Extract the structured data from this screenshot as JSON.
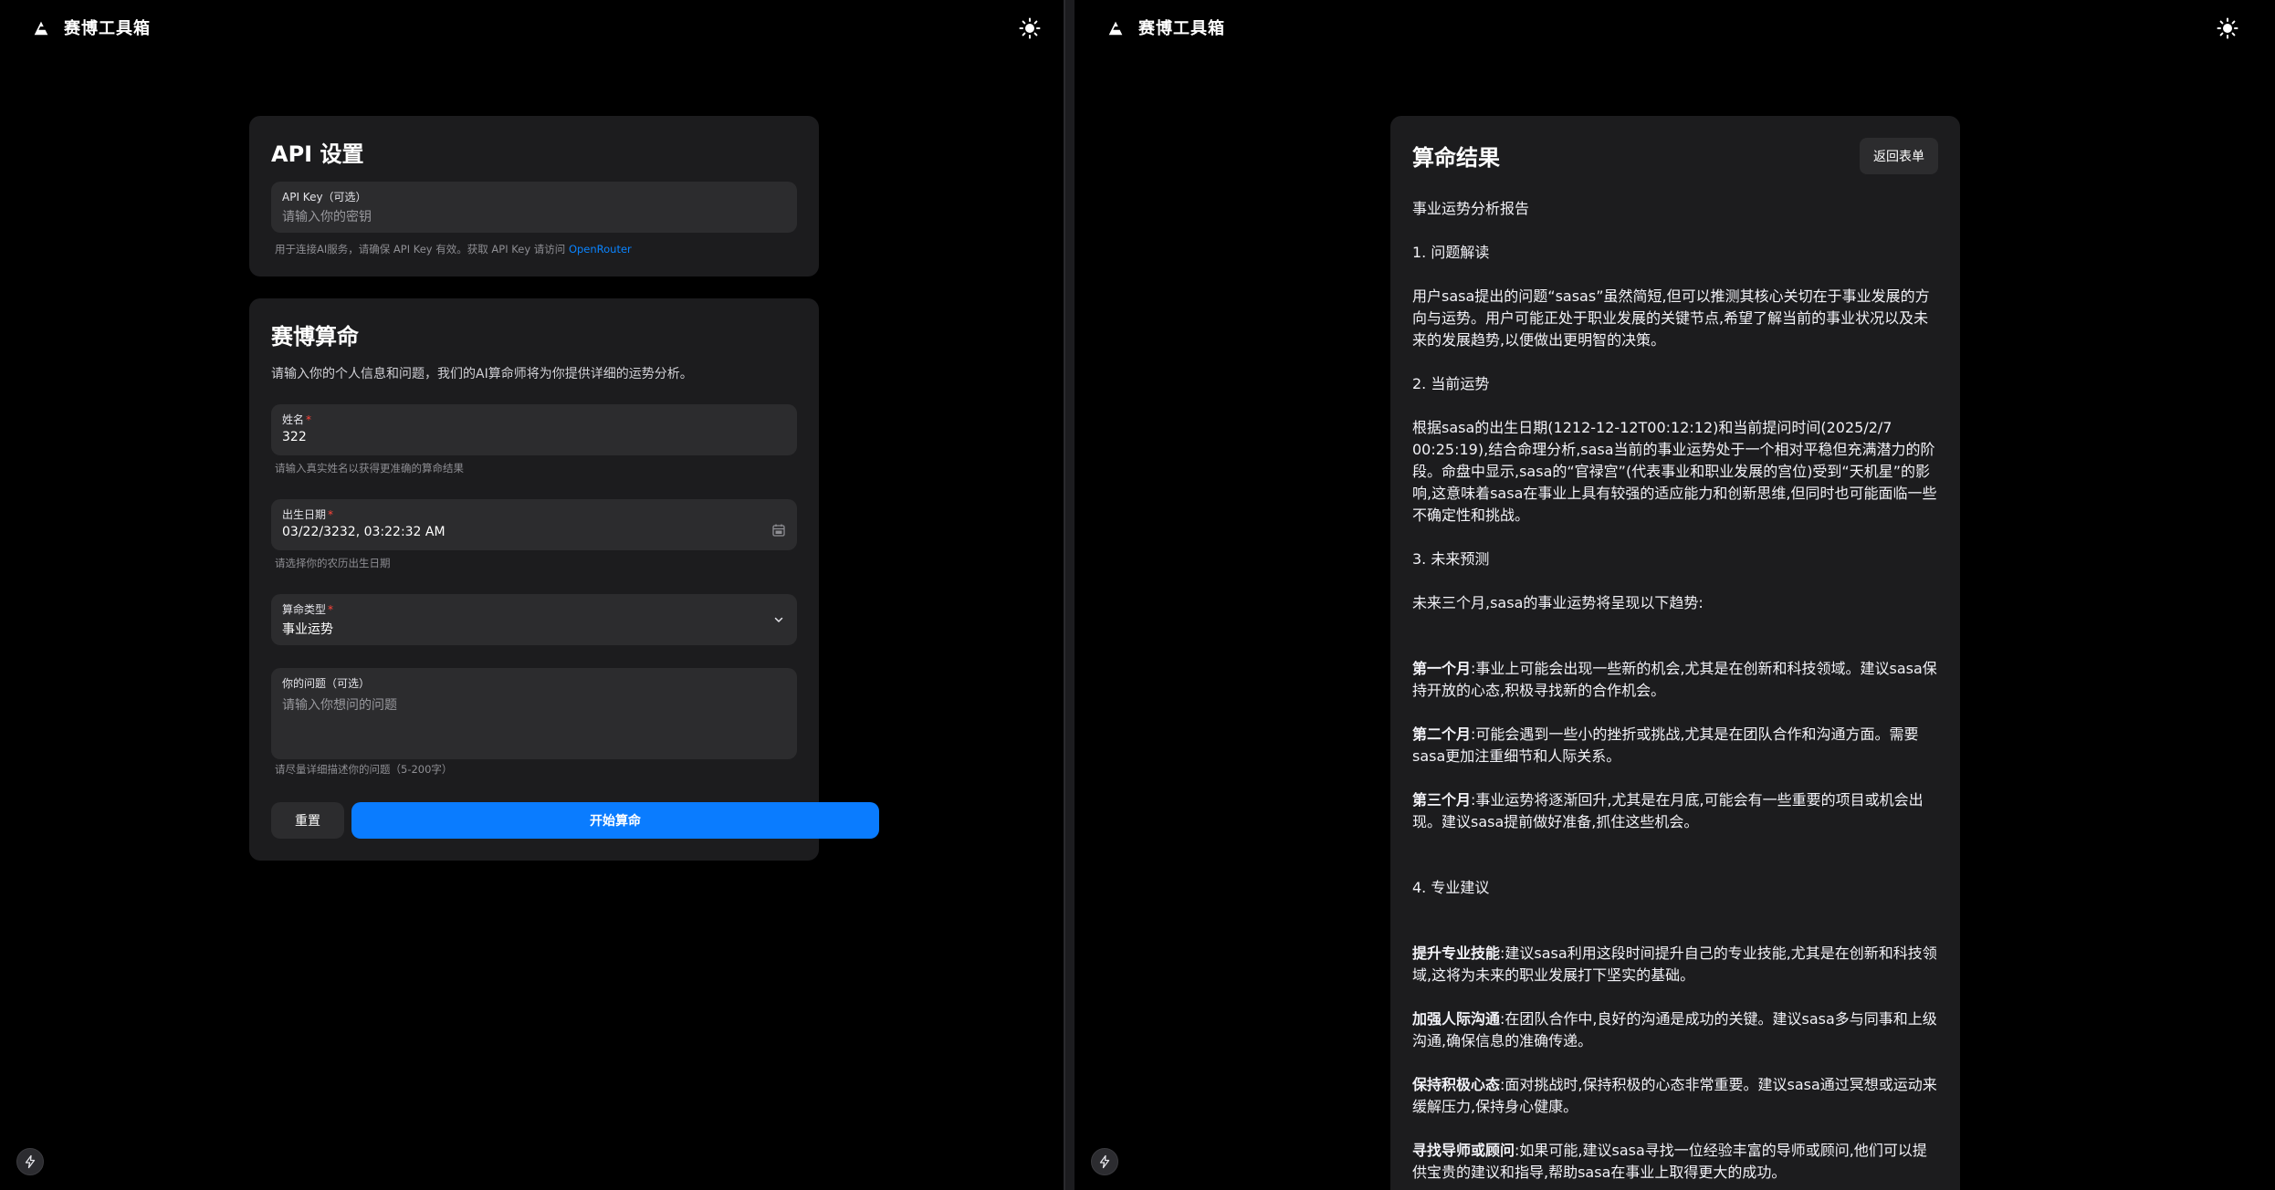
{
  "app": {
    "brand_name": "赛博工具箱"
  },
  "api_card": {
    "title": "API 设置",
    "key_label": "API Key（可选）",
    "key_placeholder": "请输入你的密钥",
    "hint_prefix": "用于连接AI服务，请确保 API Key 有效。获取 API Key 请访问",
    "hint_link": "OpenRouter"
  },
  "form_card": {
    "title": "赛博算命",
    "description": "请输入你的个人信息和问题，我们的AI算命师将为你提供详细的运势分析。",
    "name_label": "姓名",
    "name_value": "322",
    "name_hint": "请输入真实姓名以获得更准确的算命结果",
    "birth_label": "出生日期",
    "birth_value": "03/22/3232, 03:22:32 AM",
    "birth_hint": "请选择你的农历出生日期",
    "type_label": "算命类型",
    "type_value": "事业运势",
    "question_label": "你的问题（可选）",
    "question_placeholder": "请输入你想问的问题",
    "question_hint": "请尽量详细描述你的问题（5-200字）",
    "reset_label": "重置",
    "submit_label": "开始算命"
  },
  "result": {
    "title": "算命结果",
    "back_label": "返回表单",
    "report_title": "事业运势分析报告",
    "s1_heading": "1. 问题解读",
    "s1_text": "用户sasa提出的问题“sasas”虽然简短,但可以推测其核心关切在于事业发展的方向与运势。用户可能正处于职业发展的关键节点,希望了解当前的事业状况以及未来的发展趋势,以便做出更明智的决策。",
    "s2_heading": "2. 当前运势",
    "s2_text": "根据sasa的出生日期(1212-12-12T00:12:12)和当前提问时间(2025/2/7 00:25:19),结合命理分析,sasa当前的事业运势处于一个相对平稳但充满潜力的阶段。命盘中显示,sasa的“官禄宫”(代表事业和职业发展的宫位)受到“天机星”的影响,这意味着sasa在事业上具有较强的适应能力和创新思维,但同时也可能面临一些不确定性和挑战。",
    "s3_heading": "3. 未来预测",
    "s3_intro": "未来三个月,sasa的事业运势将呈现以下趋势:",
    "m1_label": "第一个月",
    "m1_text": ":事业上可能会出现一些新的机会,尤其是在创新和科技领域。建议sasa保持开放的心态,积极寻找新的合作机会。",
    "m2_label": "第二个月",
    "m2_text": ":可能会遇到一些小的挫折或挑战,尤其是在团队合作和沟通方面。需要sasa更加注重细节和人际关系。",
    "m3_label": "第三个月",
    "m3_text": ":事业运势将逐渐回升,尤其是在月底,可能会有一些重要的项目或机会出现。建议sasa提前做好准备,抓住这些机会。",
    "s4_heading": "4. 专业建议",
    "a1_label": "提升专业技能",
    "a1_text": ":建议sasa利用这段时间提升自己的专业技能,尤其是在创新和科技领域,这将为未来的职业发展打下坚实的基础。",
    "a2_label": "加强人际沟通",
    "a2_text": ":在团队合作中,良好的沟通是成功的关键。建议sasa多与同事和上级沟通,确保信息的准确传递。",
    "a3_label": "保持积极心态",
    "a3_text": ":面对挑战时,保持积极的心态非常重要。建议sasa通过冥想或运动来缓解压力,保持身心健康。",
    "a4_label": "寻找导师或顾问",
    "a4_text": ":如果可能,建议sasa寻找一位经验丰富的导师或顾问,他们可以提供宝贵的建议和指导,帮助sasa在事业上取得更大的成功。"
  },
  "icons": {
    "logo": "logo-icon",
    "theme": "sun-icon",
    "dev": "bolt-icon",
    "calendar": "calendar-icon",
    "dropdown": "chevron-down-icon"
  },
  "colors": {
    "background": "#000000",
    "card": "#1c1c1e",
    "field": "#2c2c2e",
    "accent": "#0a7cff",
    "required": "#ff453a",
    "link": "#0a84ff"
  }
}
